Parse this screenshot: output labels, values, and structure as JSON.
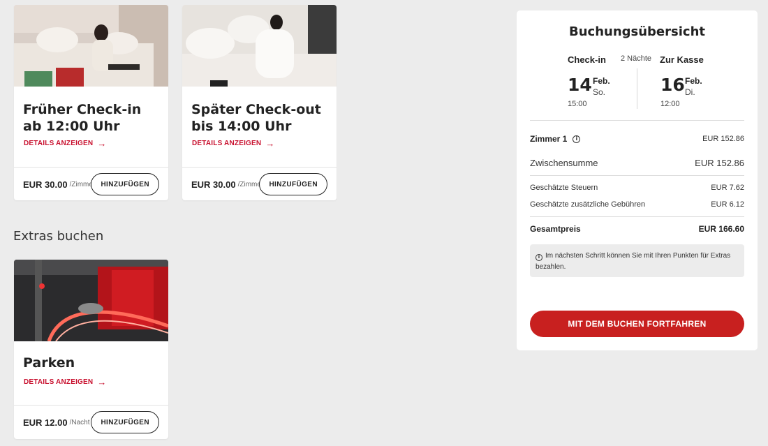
{
  "offers": [
    {
      "title": "Früher Check-in ab 12:00 Uhr",
      "details_label": "DETAILS ANZEIGEN",
      "price": "EUR 30.00",
      "per": "/Zimmer",
      "add_label": "HINZUFÜGEN",
      "image": "woman-reading-on-sofa-photo"
    },
    {
      "title": "Später Check-out bis 14:00 Uhr",
      "details_label": "DETAILS ANZEIGEN",
      "price": "EUR 30.00",
      "per": "/Zimmer",
      "add_label": "HINZUFÜGEN",
      "image": "woman-in-bathrobe-bed-photo"
    }
  ],
  "extras": {
    "heading": "Extras buchen",
    "items": [
      {
        "title": "Parken",
        "details_label": "DETAILS ANZEIGEN",
        "price": "EUR 12.00",
        "per": "/Nacht",
        "add_label": "HINZUFÜGEN",
        "image": "parking-garage-photo"
      }
    ]
  },
  "summary": {
    "title": "Buchungsübersicht",
    "checkin_label": "Check-in",
    "nights": "2 Nächte",
    "checkout_label": "Zur Kasse",
    "checkin": {
      "day": "14",
      "month": "Feb.",
      "weekday": "So.",
      "time": "15:00"
    },
    "checkout": {
      "day": "16",
      "month": "Feb.",
      "weekday": "Di.",
      "time": "12:00"
    },
    "room_label": "Zimmer 1",
    "room_price": "EUR 152.86",
    "subtotal_label": "Zwischensumme",
    "subtotal": "EUR 152.86",
    "taxes_label": "Geschätzte Steuern",
    "taxes": "EUR 7.62",
    "fees_label": "Geschätzte zusätzliche Gebühren",
    "fees": "EUR 6.12",
    "total_label": "Gesamtpreis",
    "total": "EUR 166.60",
    "notice": "Im nächsten Schritt können Sie mit Ihren Punkten für Extras bezahlen.",
    "cta_label": "MIT DEM BUCHEN FORTFAHREN"
  },
  "colors": {
    "accent": "#c8102e",
    "button": "#c8201f",
    "background": "#ececec"
  },
  "icons": [
    "arrow-right-icon",
    "info-icon"
  ]
}
